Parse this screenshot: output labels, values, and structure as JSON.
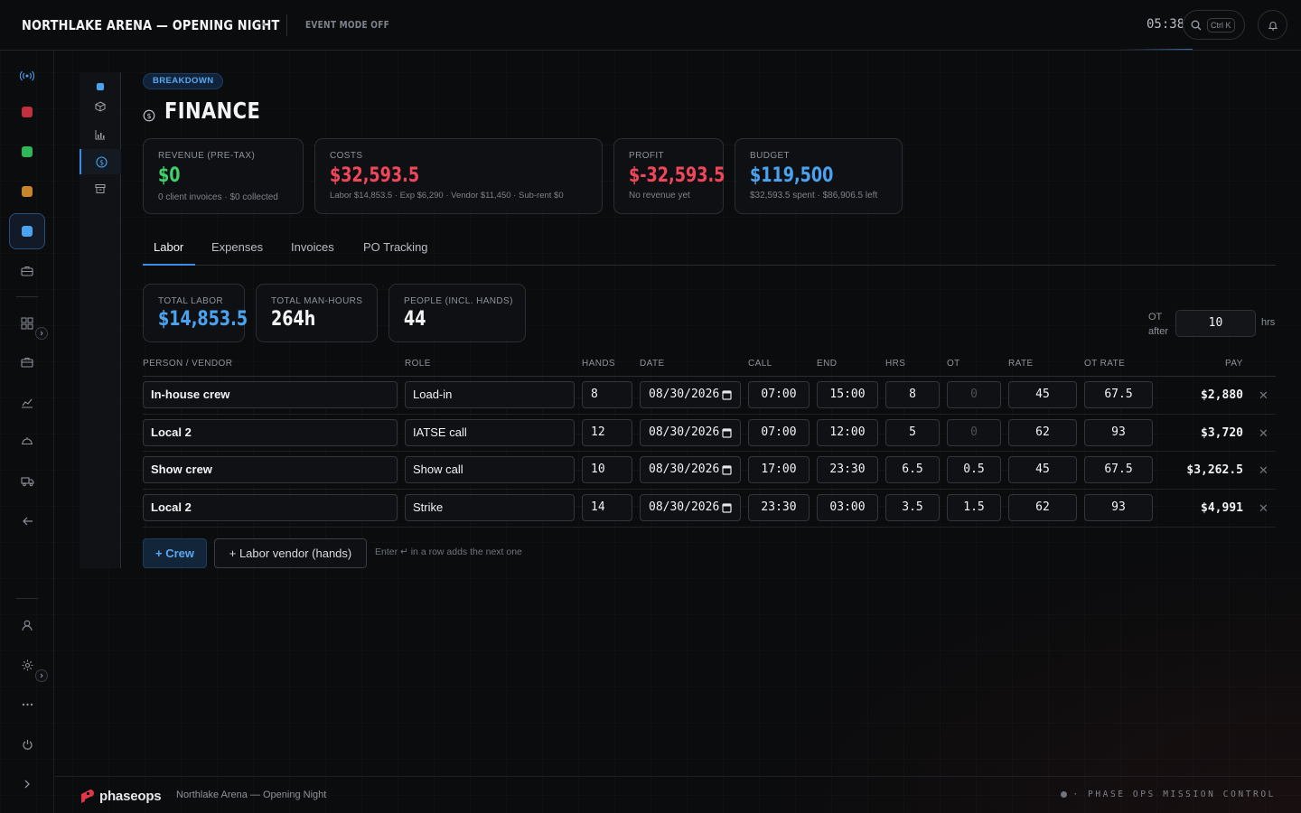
{
  "header": {
    "title": "NORTHLAKE ARENA — OPENING NIGHT",
    "event_mode": "EVENT MODE OFF",
    "clock": "05:38",
    "search_shortcut": "Ctrl K"
  },
  "page": {
    "badge": "BREAKDOWN",
    "title": "FINANCE"
  },
  "summary_cards": {
    "revenue": {
      "label": "REVENUE (PRE-TAX)",
      "value": "$0",
      "sub": "0 client invoices · $0 collected"
    },
    "costs": {
      "label": "COSTS",
      "value": "$32,593.5",
      "sub": "Labor $14,853.5 · Exp $6,290 · Vendor $11,450 · Sub-rent $0"
    },
    "profit": {
      "label": "PROFIT",
      "value": "$-32,593.5",
      "sub": "No revenue yet"
    },
    "budget": {
      "label": "BUDGET",
      "value": "$119,500",
      "sub": "$32,593.5 spent · $86,906.5 left"
    }
  },
  "tabs": [
    "Labor",
    "Expenses",
    "Invoices",
    "PO Tracking"
  ],
  "labor_stats": {
    "total_labor": {
      "label": "TOTAL LABOR",
      "value": "$14,853.5"
    },
    "man_hours": {
      "label": "TOTAL MAN-HOURS",
      "value": "264h"
    },
    "people": {
      "label": "PEOPLE (INCL. HANDS)",
      "value": "44"
    }
  },
  "ot": {
    "label_line1": "OT",
    "label_line2": "after",
    "value": "10",
    "unit": "hrs"
  },
  "table": {
    "columns": [
      "PERSON / VENDOR",
      "ROLE",
      "HANDS",
      "DATE",
      "CALL",
      "END",
      "HRS",
      "OT",
      "RATE",
      "OT RATE",
      "PAY"
    ],
    "rows": [
      {
        "person": "In-house crew",
        "role": "Load-in",
        "hands": "8",
        "date": "08/30/2026",
        "call": "07:00",
        "end": "15:00",
        "hrs": "8",
        "ot": "0",
        "rate": "45",
        "ot_rate": "67.5",
        "pay": "$2,880"
      },
      {
        "person": "Local 2",
        "role": "IATSE call",
        "hands": "12",
        "date": "08/30/2026",
        "call": "07:00",
        "end": "12:00",
        "hrs": "5",
        "ot": "0",
        "rate": "62",
        "ot_rate": "93",
        "pay": "$3,720"
      },
      {
        "person": "Show crew",
        "role": "Show call",
        "hands": "10",
        "date": "08/30/2026",
        "call": "17:00",
        "end": "23:30",
        "hrs": "6.5",
        "ot": "0.5",
        "rate": "45",
        "ot_rate": "67.5",
        "pay": "$3,262.5"
      },
      {
        "person": "Local 2",
        "role": "Strike",
        "hands": "14",
        "date": "08/30/2026",
        "call": "23:30",
        "end": "03:00",
        "hrs": "3.5",
        "ot": "1.5",
        "rate": "62",
        "ot_rate": "93",
        "pay": "$4,991"
      }
    ]
  },
  "actions": {
    "add_crew": "+ Crew",
    "add_vendor": "+ Labor vendor (hands)",
    "hint": "Enter ↵ in a row adds the next one"
  },
  "footer": {
    "brand": "phaseops",
    "event": "Northlake Arena — Opening Night",
    "tagline": "· PHASE OPS MISSION CONTROL"
  },
  "colors": {
    "accent": "#3b8ee6",
    "positive": "#3fcf6b",
    "negative": "#f0465a",
    "rail_red": "#c0303e",
    "rail_green": "#2fb757",
    "rail_orange": "#c6852a",
    "rail_blue": "#4aa3f0"
  },
  "icons": [
    "broadcast-icon",
    "cube-icon",
    "bar-chart-icon",
    "dollar-icon",
    "archive-icon",
    "briefcase-icon",
    "grid-icon",
    "toolbox-icon",
    "analytics-icon",
    "hardhat-icon",
    "truck-icon",
    "arrow-left-icon",
    "user-icon",
    "settings-icon",
    "more-icon",
    "power-icon",
    "chevron-right-icon",
    "search-icon",
    "bell-icon",
    "calendar-icon",
    "close-icon"
  ]
}
